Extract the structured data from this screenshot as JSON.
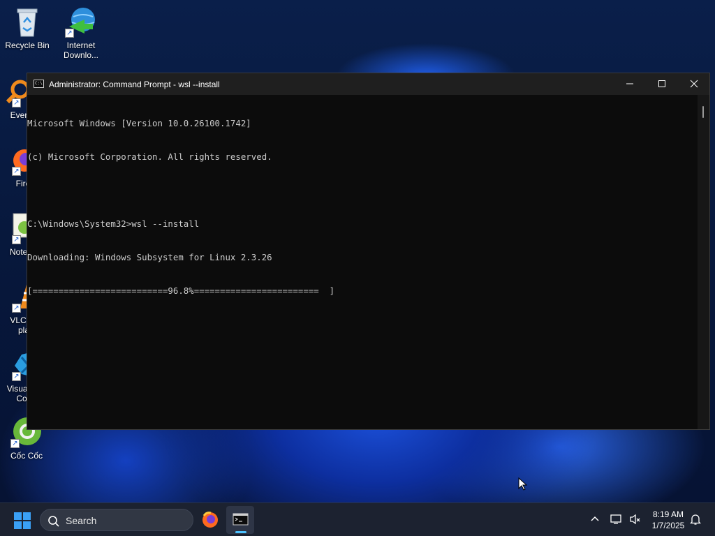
{
  "desktop": {
    "icons": [
      {
        "label": "Recycle Bin"
      },
      {
        "label": "Internet Downlo..."
      },
      {
        "label": "Every"
      },
      {
        "label": "Fire"
      },
      {
        "label": "Notep"
      },
      {
        "label": "VLC n",
        "label2": "pla"
      },
      {
        "label": "Visual",
        "label2": "Co"
      },
      {
        "label": "Cốc Cốc"
      }
    ]
  },
  "window": {
    "title": "Administrator: Command Prompt - wsl  --install",
    "icon_text": "C:\\",
    "console_lines": [
      "Microsoft Windows [Version 10.0.26100.1742]",
      "(c) Microsoft Corporation. All rights reserved.",
      "",
      "C:\\Windows\\System32>wsl --install",
      "Downloading: Windows Subsystem for Linux 2.3.26",
      "[==========================96.8%========================  ]"
    ]
  },
  "taskbar": {
    "search_label": "Search",
    "time": "8:19 AM",
    "date": "1/7/2025"
  },
  "colors": {
    "accent": "#4cc2ff",
    "console_bg": "#0c0c0c",
    "console_fg": "#cccccc"
  }
}
